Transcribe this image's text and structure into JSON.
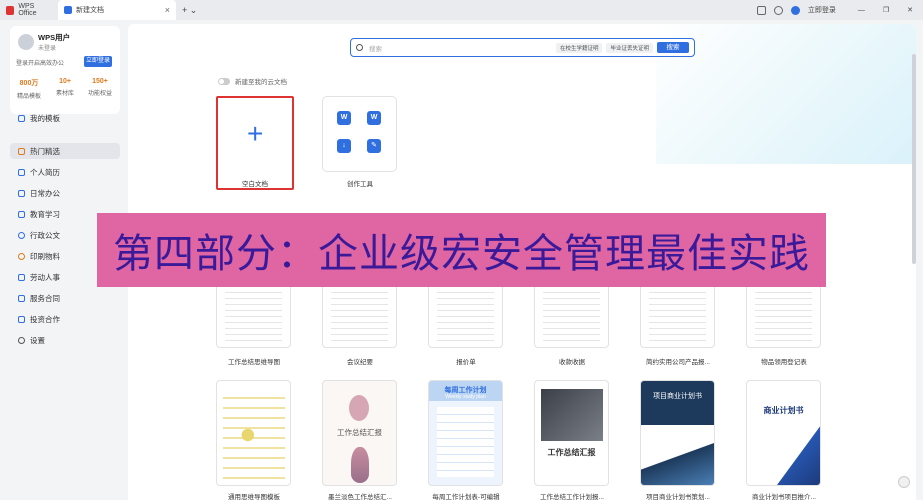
{
  "titlebar": {
    "app_tab": "WPS Office",
    "doc_tab": "新建文档",
    "close": "×",
    "new_tab": "+ ⌄",
    "login": "立即登录",
    "win_min": "—",
    "win_restore": "❐",
    "win_close": "✕"
  },
  "user": {
    "name": "WPS用户",
    "status": "未登录",
    "tip": "登录开启高效办公",
    "login_btn": "立即登录",
    "stats": [
      {
        "value": "800万",
        "label": "精品模板"
      },
      {
        "value": "10+",
        "label": "素材库"
      },
      {
        "value": "150+",
        "label": "功能权益"
      }
    ]
  },
  "sidebar": {
    "items": [
      {
        "label": "我的模板"
      },
      {
        "label": "热门精选"
      },
      {
        "label": "个人简历"
      },
      {
        "label": "日常办公"
      },
      {
        "label": "教育学习"
      },
      {
        "label": "行政公文"
      },
      {
        "label": "印刷物料"
      },
      {
        "label": "劳动人事"
      },
      {
        "label": "服务合同"
      },
      {
        "label": "投资合作"
      },
      {
        "label": "设置"
      }
    ]
  },
  "search": {
    "placeholder": "搜索",
    "tags": [
      "在校生学籍证明",
      "毕业证丢失证明"
    ],
    "button": "搜索"
  },
  "cloud_toggle": "新建至我的云文档",
  "cards": {
    "blank": "空白文档",
    "tools": "创作工具",
    "tool_icons": [
      "W",
      "W",
      "↓",
      "✎"
    ]
  },
  "banner": "第四部分：企业级宏安全管理最佳实践",
  "templates_row1": [
    "工作总结思维导图",
    "会议纪要",
    "报价单",
    "收款收据",
    "简约实用公司产品报...",
    "物品领用登记表"
  ],
  "templates_row2": [
    "通用思维导图模板",
    "墨兰淡色工作总结汇...",
    "每周工作计划表-可编辑",
    "工作总结工作计划报...",
    "项目商业计划书策划...",
    "商业计划书项目推介..."
  ],
  "poster_text": {
    "p2": "工作总结汇报",
    "p3": "每周工作计划",
    "p3_sub": "Weekly study plan",
    "p4": "工作总结汇报",
    "p5": "项目商业计划书",
    "p6": "商业计划书"
  }
}
